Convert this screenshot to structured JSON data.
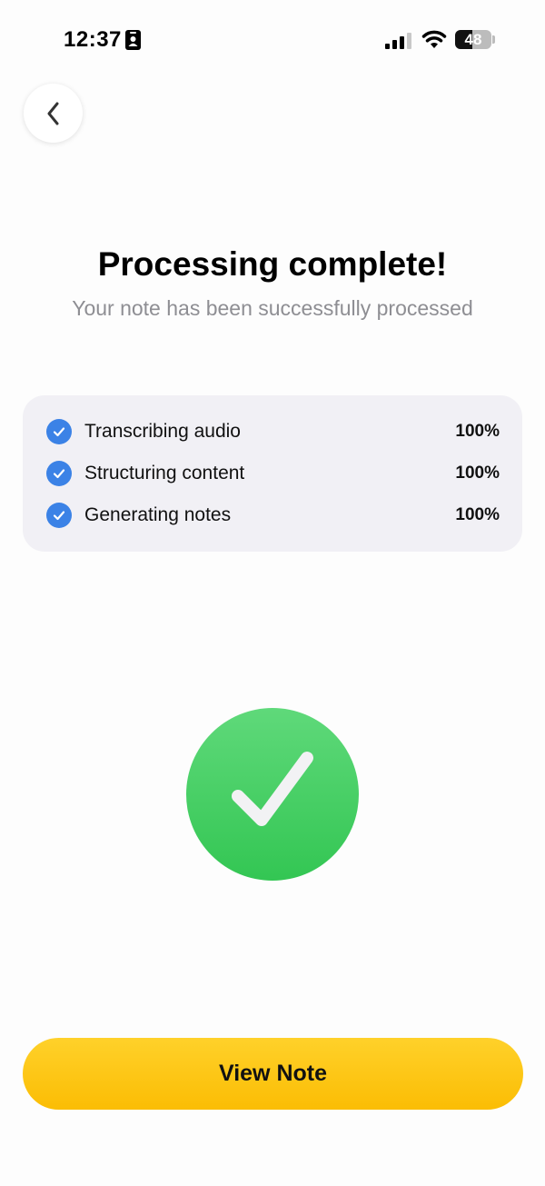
{
  "status_bar": {
    "time": "12:37",
    "battery_level": "48",
    "battery_fraction": 0.48,
    "icons": [
      "id-card-icon",
      "signal-icon",
      "wifi-icon",
      "battery-icon"
    ]
  },
  "header": {
    "back_icon": "chevron-left-icon",
    "title": "Processing complete!",
    "subtitle": "Your note has been successfully processed"
  },
  "steps": [
    {
      "label": "Transcribing audio",
      "percent": "100%"
    },
    {
      "label": "Structuring content",
      "percent": "100%"
    },
    {
      "label": "Generating notes",
      "percent": "100%"
    }
  ],
  "success_icon": "checkmark-icon",
  "cta": {
    "label": "View Note"
  },
  "colors": {
    "accent_yellow": "#fbbd04",
    "success_green": "#33c653",
    "check_blue": "#3b82e6",
    "card_background": "#f1f0f5",
    "subtitle_gray": "#8e8e93"
  }
}
